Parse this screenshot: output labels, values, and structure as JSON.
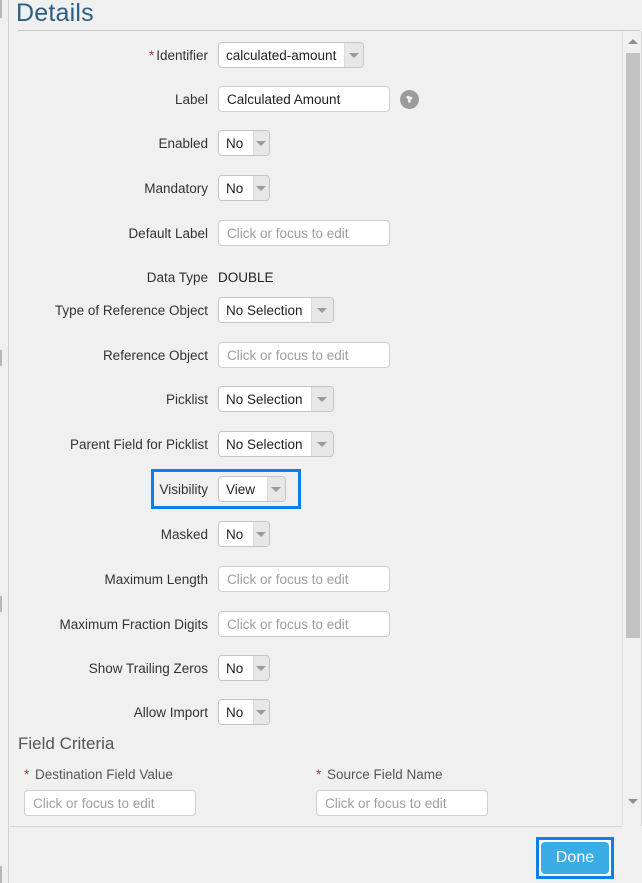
{
  "header": {
    "title": "Details"
  },
  "form": {
    "rows": [
      {
        "label": "Identifier",
        "required": true,
        "control": "combo",
        "value": "calculated-amount",
        "width": "w-ident"
      },
      {
        "label": "Label",
        "required": false,
        "control": "text",
        "value": "Calculated Amount",
        "icon": "globe-icon"
      },
      {
        "label": "Enabled",
        "required": false,
        "control": "combo",
        "value": "No",
        "width": "w-yesno"
      },
      {
        "label": "Mandatory",
        "required": false,
        "control": "combo",
        "value": "No",
        "width": "w-yesno"
      },
      {
        "label": "Default Label",
        "required": false,
        "control": "text",
        "value": "",
        "placeholder": "Click or focus to edit"
      },
      {
        "label": "Data Type",
        "required": false,
        "control": "static",
        "value": "DOUBLE"
      },
      {
        "label": "Type of Reference Object",
        "required": false,
        "control": "combo",
        "value": "No Selection",
        "width": "w-nosel"
      },
      {
        "label": "Reference Object",
        "required": false,
        "control": "text",
        "value": "",
        "placeholder": "Click or focus to edit"
      },
      {
        "label": "Picklist",
        "required": false,
        "control": "combo",
        "value": "No Selection",
        "width": "w-nosel"
      },
      {
        "label": "Parent Field for Picklist",
        "required": false,
        "control": "combo",
        "value": "No Selection",
        "width": "w-nosel"
      },
      {
        "label": "Visibility",
        "required": false,
        "control": "combo",
        "value": "View",
        "width": "w-view",
        "focused": true
      },
      {
        "label": "Masked",
        "required": false,
        "control": "combo",
        "value": "No",
        "width": "w-yesno"
      },
      {
        "label": "Maximum Length",
        "required": false,
        "control": "text",
        "value": "",
        "placeholder": "Click or focus to edit"
      },
      {
        "label": "Maximum Fraction Digits",
        "required": false,
        "control": "text",
        "value": "",
        "placeholder": "Click or focus to edit"
      },
      {
        "label": "Show Trailing Zeros",
        "required": false,
        "control": "combo",
        "value": "No",
        "width": "w-yesno"
      },
      {
        "label": "Allow Import",
        "required": false,
        "control": "combo",
        "value": "No",
        "width": "w-yesno"
      }
    ]
  },
  "field_criteria": {
    "title": "Field Criteria",
    "destination": {
      "label": "Destination Field Value",
      "required": true,
      "value": "",
      "placeholder": "Click or focus to edit"
    },
    "source": {
      "label": "Source Field Name",
      "required": true,
      "value": "",
      "placeholder": "Click or focus to edit"
    }
  },
  "footer": {
    "done_label": "Done"
  },
  "colors": {
    "accent_focus": "#0c7fe8",
    "button_fill": "#3aade7",
    "title": "#2b5f84",
    "required_star": "#a33c3c",
    "panel_bg": "#f0f0f0"
  }
}
